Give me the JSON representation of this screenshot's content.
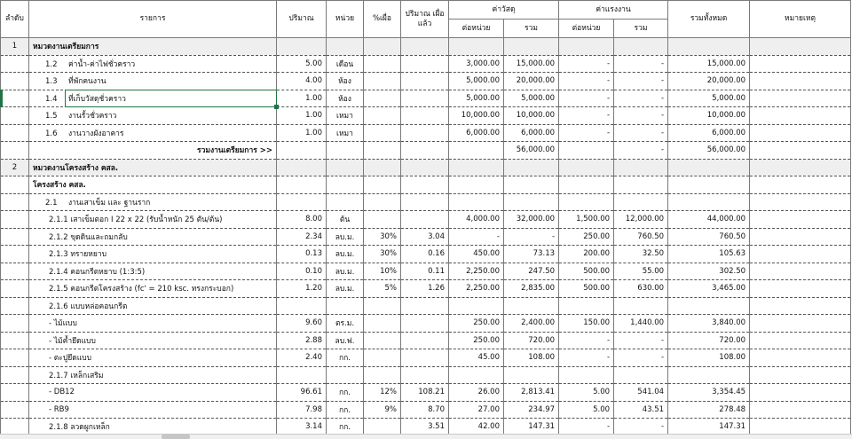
{
  "headers": {
    "no": "ลำดับ",
    "item": "รายการ",
    "qty": "ปริมาณ",
    "unit": "หน่วย",
    "waste_pct": "%เผื่อ",
    "qty_waste": "ปริมาณ เผื่อแล้ว",
    "material": "ค่าวัสดุ",
    "labor": "ค่าแรงงาน",
    "per_unit": "ต่อหน่วย",
    "sum": "รวม",
    "grand_total": "รวมทั้งหมด",
    "remark": "หมายเหตุ"
  },
  "rows": [
    {
      "type": "section",
      "no": "1",
      "code": "",
      "desc": "หมวดงานเตรียมการ",
      "qty": "",
      "unit": "",
      "waste": "",
      "qw": "",
      "mu": "",
      "ms": "",
      "lu": "",
      "ls": "",
      "total": ""
    },
    {
      "type": "item",
      "no": "",
      "code": "1.2",
      "desc": "ค่าน้ำ-ค่าไฟชั่วคราว",
      "qty": "5.00",
      "unit": "เดือน",
      "waste": "",
      "qw": "",
      "mu": "3,000.00",
      "ms": "15,000.00",
      "lu": "-",
      "ls": "-",
      "total": "15,000.00"
    },
    {
      "type": "item",
      "no": "",
      "code": "1.3",
      "desc": "ที่พักคนงาน",
      "qty": "4.00",
      "unit": "ห้อง",
      "waste": "",
      "qw": "",
      "mu": "5,000.00",
      "ms": "20,000.00",
      "lu": "-",
      "ls": "-",
      "total": "20,000.00"
    },
    {
      "type": "item",
      "no": "",
      "code": "1.4",
      "desc": "ที่เก็บวัสดุชั่วคราว",
      "qty": "1.00",
      "unit": "ห้อง",
      "waste": "",
      "qw": "",
      "mu": "5,000.00",
      "ms": "5,000.00",
      "lu": "-",
      "ls": "-",
      "total": "5,000.00",
      "selected": true
    },
    {
      "type": "item",
      "no": "",
      "code": "1.5",
      "desc": "งานรั้วชั่วคราว",
      "qty": "1.00",
      "unit": "เหมา",
      "waste": "",
      "qw": "",
      "mu": "10,000.00",
      "ms": "10,000.00",
      "lu": "-",
      "ls": "-",
      "total": "10,000.00"
    },
    {
      "type": "item",
      "no": "",
      "code": "1.6",
      "desc": "งานวางผังอาคาร",
      "qty": "1.00",
      "unit": "เหมา",
      "waste": "",
      "qw": "",
      "mu": "6,000.00",
      "ms": "6,000.00",
      "lu": "-",
      "ls": "-",
      "total": "6,000.00"
    },
    {
      "type": "total",
      "no": "",
      "code": "",
      "desc": "รวมงานเตรียมการ  >>",
      "qty": "",
      "unit": "",
      "waste": "",
      "qw": "",
      "mu": "",
      "ms": "56,000.00",
      "lu": "",
      "ls": "-",
      "total": "56,000.00"
    },
    {
      "type": "section",
      "no": "2",
      "code": "",
      "desc": "หมวดงานโครงสร้าง คสล.",
      "qty": "",
      "unit": "",
      "waste": "",
      "qw": "",
      "mu": "",
      "ms": "",
      "lu": "",
      "ls": "",
      "total": ""
    },
    {
      "type": "subhead",
      "no": "",
      "code": "",
      "desc": "โครงสร้าง คสล.",
      "qty": "",
      "unit": "",
      "waste": "",
      "qw": "",
      "mu": "",
      "ms": "",
      "lu": "",
      "ls": "",
      "total": ""
    },
    {
      "type": "item",
      "no": "",
      "code": "2.1",
      "desc": "งานเสาเข็ม และ ฐานราก",
      "qty": "",
      "unit": "",
      "waste": "",
      "qw": "",
      "mu": "",
      "ms": "",
      "lu": "",
      "ls": "",
      "total": ""
    },
    {
      "type": "detail",
      "no": "",
      "code": "",
      "desc": "2.1.1 เสาเข็มตอก I 22 x 22 (รับน้ำหนัก 25 ตัน/ต้น)",
      "qty": "8.00",
      "unit": "ต้น",
      "waste": "",
      "qw": "",
      "mu": "4,000.00",
      "ms": "32,000.00",
      "lu": "1,500.00",
      "ls": "12,000.00",
      "total": "44,000.00"
    },
    {
      "type": "detail",
      "no": "",
      "code": "",
      "desc": "2.1.2 ขุดดินและถมกลับ",
      "qty": "2.34",
      "unit": "ลบ.ม.",
      "waste": "30%",
      "qw": "3.04",
      "mu": "-",
      "ms": "-",
      "lu": "250.00",
      "ls": "760.50",
      "total": "760.50"
    },
    {
      "type": "detail",
      "no": "",
      "code": "",
      "desc": "2.1.3 ทรายหยาบ",
      "qty": "0.13",
      "unit": "ลบ.ม.",
      "waste": "30%",
      "qw": "0.16",
      "mu": "450.00",
      "ms": "73.13",
      "lu": "200.00",
      "ls": "32.50",
      "total": "105.63"
    },
    {
      "type": "detail",
      "no": "",
      "code": "",
      "desc": "2.1.4 คอนกรีตหยาบ (1:3:5)",
      "qty": "0.10",
      "unit": "ลบ.ม.",
      "waste": "10%",
      "qw": "0.11",
      "mu": "2,250.00",
      "ms": "247.50",
      "lu": "500.00",
      "ls": "55.00",
      "total": "302.50"
    },
    {
      "type": "detail",
      "no": "",
      "code": "",
      "desc": "2.1.5 คอนกรีตโครงสร้าง (fc' = 210 ksc. ทรงกระบอก)",
      "qty": "1.20",
      "unit": "ลบ.ม.",
      "waste": "5%",
      "qw": "1.26",
      "mu": "2,250.00",
      "ms": "2,835.00",
      "lu": "500.00",
      "ls": "630.00",
      "total": "3,465.00"
    },
    {
      "type": "detail",
      "no": "",
      "code": "",
      "desc": "2.1.6 แบบหล่อคอนกรีต",
      "qty": "",
      "unit": "",
      "waste": "",
      "qw": "",
      "mu": "",
      "ms": "",
      "lu": "",
      "ls": "",
      "total": ""
    },
    {
      "type": "detail",
      "no": "",
      "code": "",
      "desc": "- ไม้แบบ",
      "qty": "9.60",
      "unit": "ตร.ม.",
      "waste": "",
      "qw": "",
      "mu": "250.00",
      "ms": "2,400.00",
      "lu": "150.00",
      "ls": "1,440.00",
      "total": "3,840.00"
    },
    {
      "type": "detail",
      "no": "",
      "code": "",
      "desc": "- ไม้ค้ำยึดแบบ",
      "qty": "2.88",
      "unit": "ลบ.ฟ.",
      "waste": "",
      "qw": "",
      "mu": "250.00",
      "ms": "720.00",
      "lu": "-",
      "ls": "-",
      "total": "720.00"
    },
    {
      "type": "detail",
      "no": "",
      "code": "",
      "desc": "- ตะปูยึดแบบ",
      "qty": "2.40",
      "unit": "กก.",
      "waste": "",
      "qw": "",
      "mu": "45.00",
      "ms": "108.00",
      "lu": "-",
      "ls": "-",
      "total": "108.00"
    },
    {
      "type": "detail",
      "no": "",
      "code": "",
      "desc": "2.1.7 เหล็กเสริม",
      "qty": "",
      "unit": "",
      "waste": "",
      "qw": "",
      "mu": "",
      "ms": "",
      "lu": "",
      "ls": "",
      "total": ""
    },
    {
      "type": "detail",
      "no": "",
      "code": "",
      "desc": "- DB12",
      "qty": "96.61",
      "unit": "กก.",
      "waste": "12%",
      "qw": "108.21",
      "mu": "26.00",
      "ms": "2,813.41",
      "lu": "5.00",
      "ls": "541.04",
      "total": "3,354.45"
    },
    {
      "type": "detail",
      "no": "",
      "code": "",
      "desc": "- RB9",
      "qty": "7.98",
      "unit": "กก.",
      "waste": "9%",
      "qw": "8.70",
      "mu": "27.00",
      "ms": "234.97",
      "lu": "5.00",
      "ls": "43.51",
      "total": "278.48"
    },
    {
      "type": "detail",
      "no": "",
      "code": "",
      "desc": "2.1.8 ลวดผูกเหล็ก",
      "qty": "3.14",
      "unit": "กก.",
      "waste": "",
      "qw": "3.51",
      "mu": "42.00",
      "ms": "147.31",
      "lu": "-",
      "ls": "-",
      "total": "147.31"
    }
  ]
}
